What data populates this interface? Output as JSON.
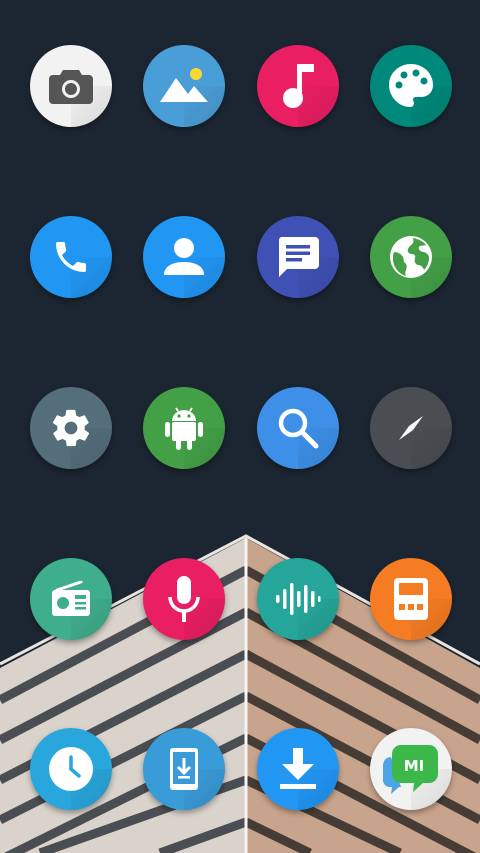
{
  "home_screen": {
    "apps": [
      {
        "name": "camera",
        "icon": "camera-icon",
        "color": "#f2f2f2"
      },
      {
        "name": "gallery",
        "icon": "gallery-icon",
        "color": "#4a9ed8"
      },
      {
        "name": "music",
        "icon": "music-note-icon",
        "color": "#e91e63"
      },
      {
        "name": "themes",
        "icon": "palette-icon",
        "color": "#00897b"
      },
      {
        "name": "phone",
        "icon": "phone-icon",
        "color": "#2196f3"
      },
      {
        "name": "contacts",
        "icon": "contact-icon",
        "color": "#2196f3"
      },
      {
        "name": "messages",
        "icon": "message-icon",
        "color": "#3f51b5"
      },
      {
        "name": "browser",
        "icon": "globe-icon",
        "color": "#43a047"
      },
      {
        "name": "settings",
        "icon": "gear-icon",
        "color": "#546e7a"
      },
      {
        "name": "android",
        "icon": "android-icon",
        "color": "#43a047"
      },
      {
        "name": "search",
        "icon": "search-icon",
        "color": "#3d8fe8"
      },
      {
        "name": "compass",
        "icon": "compass-icon",
        "color": "#4a4d52"
      },
      {
        "name": "radio",
        "icon": "radio-icon",
        "color": "#3fae8c"
      },
      {
        "name": "recorder",
        "icon": "microphone-icon",
        "color": "#e91e63"
      },
      {
        "name": "voice",
        "icon": "waveform-icon",
        "color": "#26a69a"
      },
      {
        "name": "calculator",
        "icon": "calculator-icon",
        "color": "#f57c22"
      },
      {
        "name": "clock",
        "icon": "clock-icon",
        "color": "#29a6dc"
      },
      {
        "name": "updater",
        "icon": "phone-download-icon",
        "color": "#3a9bd9"
      },
      {
        "name": "downloads",
        "icon": "download-icon",
        "color": "#2196f3"
      },
      {
        "name": "mi-talk",
        "icon": "mi-chat-icon",
        "color": "#f2f2f2"
      }
    ]
  }
}
